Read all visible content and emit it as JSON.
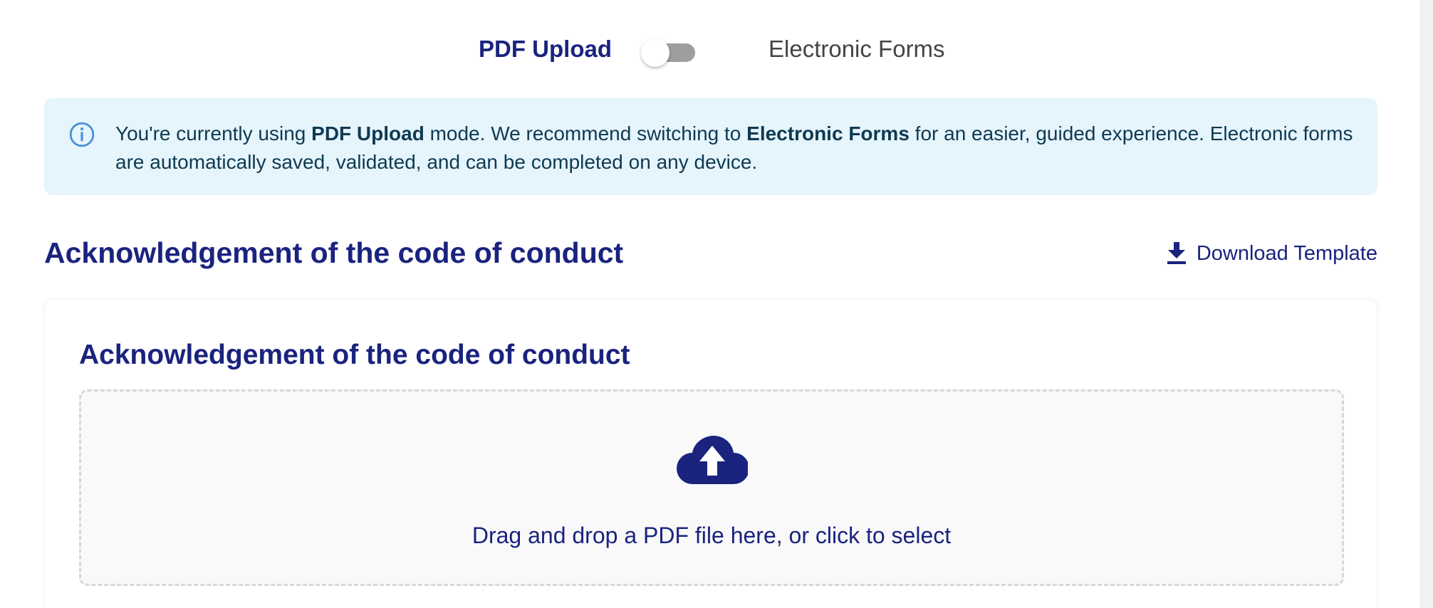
{
  "mode_switch": {
    "left_label": "PDF Upload",
    "right_label": "Electronic Forms",
    "checked": false
  },
  "alert": {
    "icon": "info-icon",
    "text_before": "You're currently using ",
    "strong_1": "PDF Upload",
    "text_middle": " mode. We recommend switching to ",
    "strong_2": "Electronic Forms",
    "text_after": " for an easier, guided experience. Electronic forms are automatically saved, validated, and can be completed on any device."
  },
  "section": {
    "title": "Acknowledgement of the code of conduct",
    "download_label": "Download Template",
    "download_icon": "download-icon"
  },
  "card": {
    "title": "Acknowledgement of the code of conduct",
    "upload_icon": "cloud-upload-icon",
    "dropzone_text": "Drag and drop a PDF file here, or click to select"
  },
  "colors": {
    "brand": "#1a237e",
    "alert_bg": "#e6f4fb",
    "alert_text": "#0e3a52",
    "info_icon": "#4a90d9",
    "toggle_track": "#9e9e9e"
  }
}
